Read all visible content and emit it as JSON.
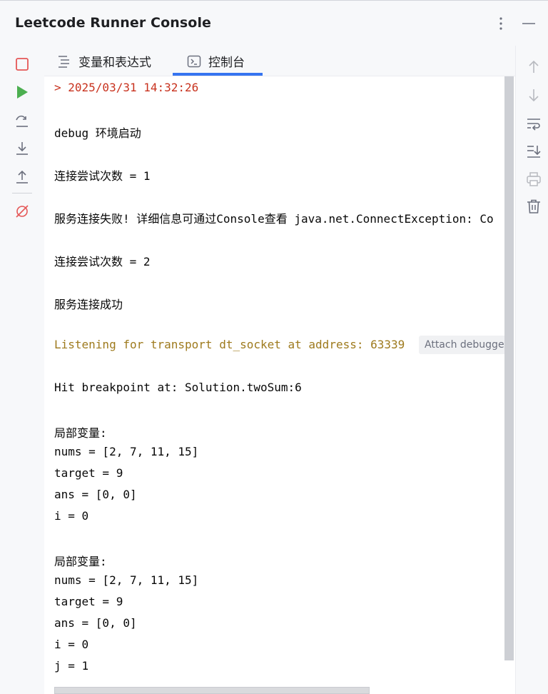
{
  "window": {
    "title": "Leetcode Runner Console"
  },
  "tabs": [
    {
      "label": "变量和表达式",
      "icon": "list-icon"
    },
    {
      "label": "控制台",
      "icon": "console-icon"
    }
  ],
  "left_toolbar": {
    "items": [
      "stop-icon",
      "resume-icon",
      "step-over-icon",
      "step-into-icon",
      "step-out-icon",
      "mute-breakpoints-icon"
    ]
  },
  "right_toolbar": {
    "items": [
      "up-arrow-icon",
      "down-arrow-icon",
      "soft-wrap-icon",
      "scroll-to-end-icon",
      "print-icon",
      "trash-icon"
    ]
  },
  "console": {
    "timestamp": "> 2025/03/31 14:32:26",
    "debug_start": "debug 环境启动",
    "attempt1": "连接尝试次数 = 1",
    "fail": "服务连接失败! 详细信息可通过Console查看 java.net.ConnectException: Co",
    "attempt2": "连接尝试次数 = 2",
    "success": "服务连接成功",
    "listening": "Listening for transport dt_socket at address: 63339",
    "attach_debugger": "Attach debugger",
    "hit_breakpoint": "Hit breakpoint at: Solution.twoSum:6",
    "block1": {
      "header": "局部变量:",
      "nums": "nums = [2, 7, 11, 15]",
      "target": "target = 9",
      "ans": "ans = [0, 0]",
      "i": "i = 0"
    },
    "block2": {
      "header": "局部变量:",
      "nums": "nums = [2, 7, 11, 15]",
      "target": "target = 9",
      "ans": "ans = [0, 0]",
      "i": "i = 0",
      "j": "j = 1"
    }
  },
  "colors": {
    "accent": "#3574f0",
    "timestamp_red": "#c8321e",
    "listening_orange": "#9e7a1d",
    "run_green": "#4caf50",
    "stop_red": "#e55757"
  }
}
